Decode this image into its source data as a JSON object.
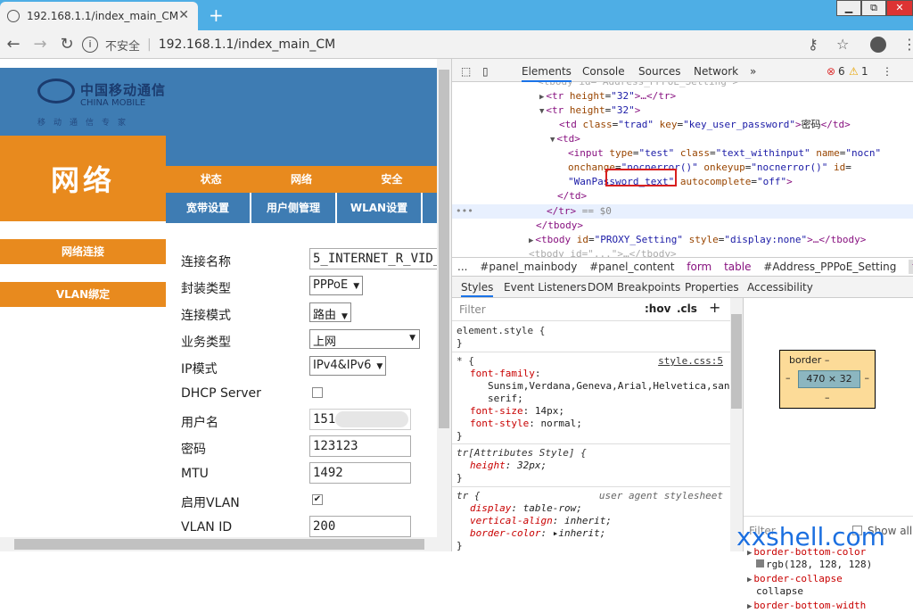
{
  "browser": {
    "tab_title": "192.168.1.1/index_main_CM",
    "new_tab": "+",
    "window_buttons": [
      "▁",
      "⧉",
      "✕"
    ],
    "security_label": "不安全",
    "url": "192.168.1.1/index_main_CM"
  },
  "page": {
    "logo_cn": "中国移动通信",
    "logo_en": "CHINA MOBILE",
    "logo_slogan": "移动通信专家",
    "section_title": "网络",
    "top_nav": [
      "状态",
      "网络",
      "安全"
    ],
    "sub_nav": [
      "宽带设置",
      "用户侧管理",
      "WLAN设置"
    ],
    "sidebar": [
      "网络连接",
      "VLAN绑定"
    ],
    "form": {
      "conn_name_label": "连接名称",
      "conn_name_value": "5_INTERNET_R_VID_",
      "encap_label": "封装类型",
      "encap_value": "PPPoE",
      "conn_mode_label": "连接模式",
      "conn_mode_value": "路由",
      "service_label": "业务类型",
      "service_value": "上网",
      "ip_mode_label": "IP模式",
      "ip_mode_value": "IPv4&IPv6",
      "dhcp_label": "DHCP Server",
      "dhcp_checked": false,
      "username_label": "用户名",
      "username_value": "151",
      "password_label": "密码",
      "password_value": "123123",
      "mtu_label": "MTU",
      "mtu_value": "1492",
      "vlan_enable_label": "启用VLAN",
      "vlan_enable_checked": true,
      "vlan_id_label": "VLAN ID",
      "vlan_id_value": "200"
    }
  },
  "devtools": {
    "tabs": [
      "Elements",
      "Console",
      "Sources",
      "Network",
      "»"
    ],
    "errors": "6",
    "warnings": "1",
    "dom": {
      "l0": "<tbody id=\"Address_PPPoE_Setting\">",
      "l1_tag": "<tr",
      "l1_attr": "height",
      "l1_val": "\"32\"",
      "l1_end": ">…</tr>",
      "l2_tag": "<tr",
      "l2_attr": "height",
      "l2_val": "\"32\"",
      "l2_end": ">",
      "l3_tag": "<td",
      "l3_a1": "class",
      "l3_v1": "\"trad\"",
      "l3_a2": "key",
      "l3_v2": "\"key_user_password\"",
      "l3_text": "密码",
      "l3_end": "</td>",
      "l4": "<td>",
      "l5_tag": "<input",
      "l5_a1": "type",
      "l5_v1": "\"test\"",
      "l5_a2": "class",
      "l5_v2": "\"text_withinput\"",
      "l5_a3": "name",
      "l5_v3": "\"nocn\"",
      "l6_a1": "onchange",
      "l6_v1": "\"nocnerror()\"",
      "l6_a2": "onkeyup",
      "l6_v2": "\"nocnerror()\"",
      "l6_a3": "id",
      "l7_v1": "\"WanPassword_text\"",
      "l7_a2": "autocomplete",
      "l7_v2": "\"off\"",
      "l7_end": ">",
      "l8": "</td>",
      "l9": "</tr>",
      "l9_eq": " == $0",
      "l10": "</tbody>",
      "l11_tag": "<tbody",
      "l11_a1": "id",
      "l11_v1": "\"PROXY_Setting\"",
      "l11_a2": "style",
      "l11_v2": "\"display:none\"",
      "l11_end": ">…</tbody>",
      "l12": "<tbody id=\"...\">…</tbody>"
    },
    "breadcrumbs": [
      "...",
      "#panel_mainbody",
      "#panel_content",
      "form",
      "table",
      "#Address_PPPoE_Setting",
      "tr"
    ],
    "style_tabs": [
      "Styles",
      "Event Listeners",
      "DOM Breakpoints",
      "Properties",
      "Accessibility"
    ],
    "filter_placeholder": "Filter",
    "hov": ":hov",
    "cls": ".cls",
    "plus": "+",
    "styles": {
      "r1_sel": "element.style {",
      "r1_close": "}",
      "r2_sel": "* {",
      "r2_src": "style.css:5",
      "r2_p1": "font-family",
      "r2_v1a": "Sunsim,Verdana,Geneva,Arial,Helvetica,sans-",
      "r2_v1b": "serif;",
      "r2_p2": "font-size",
      "r2_v2": "14px;",
      "r2_p3": "font-style",
      "r2_v3": "normal;",
      "r2_close": "}",
      "r3_sel": "tr[Attributes Style] {",
      "r3_p1": "height",
      "r3_v1": "32px;",
      "r3_close": "}",
      "r4_sel": "tr {",
      "r4_src": "user agent stylesheet",
      "r4_p1": "display",
      "r4_v1": "table-row;",
      "r4_p2": "vertical-align",
      "r4_v2": "inherit;",
      "r4_p3": "border-color",
      "r4_v3": "inherit;",
      "r4_close": "}"
    },
    "box_model": {
      "label": "border",
      "dash": "–",
      "content": "470 × 32"
    },
    "computed": {
      "filter": "Filter",
      "show_all": "Show all",
      "p1": "border-bottom-color",
      "v1": "rgb(128, 128, 128)",
      "p2": "border-collapse",
      "v2": "collapse",
      "p3": "border-bottom-width"
    }
  },
  "watermark": "xxshell.com"
}
